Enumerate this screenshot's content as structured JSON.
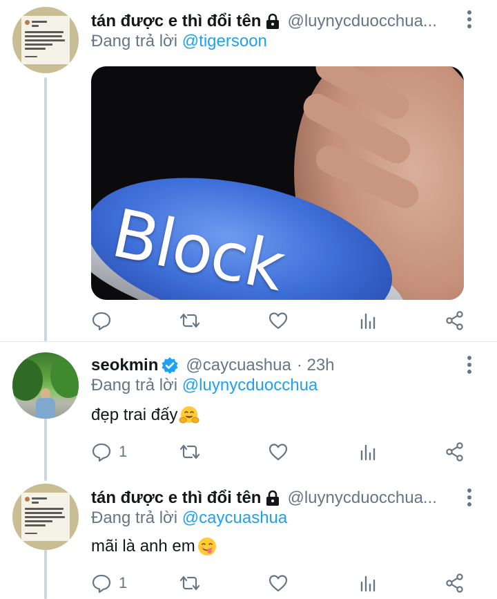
{
  "tweets": [
    {
      "name": "tán được e thì đổi tên",
      "handle": "@luynycduocchua...",
      "time": "",
      "reply_prefix": "Đang trả lời",
      "reply_to": "@tigersoon",
      "text": "",
      "media_text": "Block",
      "icons": {
        "protected": "lock-icon",
        "more": "more-vertical-icon"
      },
      "actions": {
        "reply_count": "",
        "retweet_count": "",
        "like_count": ""
      }
    },
    {
      "name": "seokmin",
      "handle": "@caycuashua",
      "time": "· 23h",
      "reply_prefix": "Đang trả lời",
      "reply_to": "@luynycduocchua",
      "text": "đẹp trai đấy",
      "emoji": "hugging-face-emoji",
      "icons": {
        "verified": "verified-badge-icon",
        "more": "more-vertical-icon"
      },
      "actions": {
        "reply_count": "1",
        "retweet_count": "",
        "like_count": ""
      }
    },
    {
      "name": "tán được e thì đổi tên",
      "handle": "@luynycduocchua...",
      "time": "",
      "reply_prefix": "Đang trả lời",
      "reply_to": "@caycuashua",
      "text": "mãi là anh em",
      "emoji": "face-savoring-food-emoji",
      "icons": {
        "protected": "lock-icon",
        "more": "more-vertical-icon"
      },
      "actions": {
        "reply_count": "1",
        "retweet_count": "",
        "like_count": ""
      }
    }
  ],
  "colors": {
    "link": "#1da1f2",
    "secondary_text": "#657786",
    "primary_text": "#14171a",
    "thread_line": "#ccd6dd",
    "verified": "#1da1f2"
  }
}
